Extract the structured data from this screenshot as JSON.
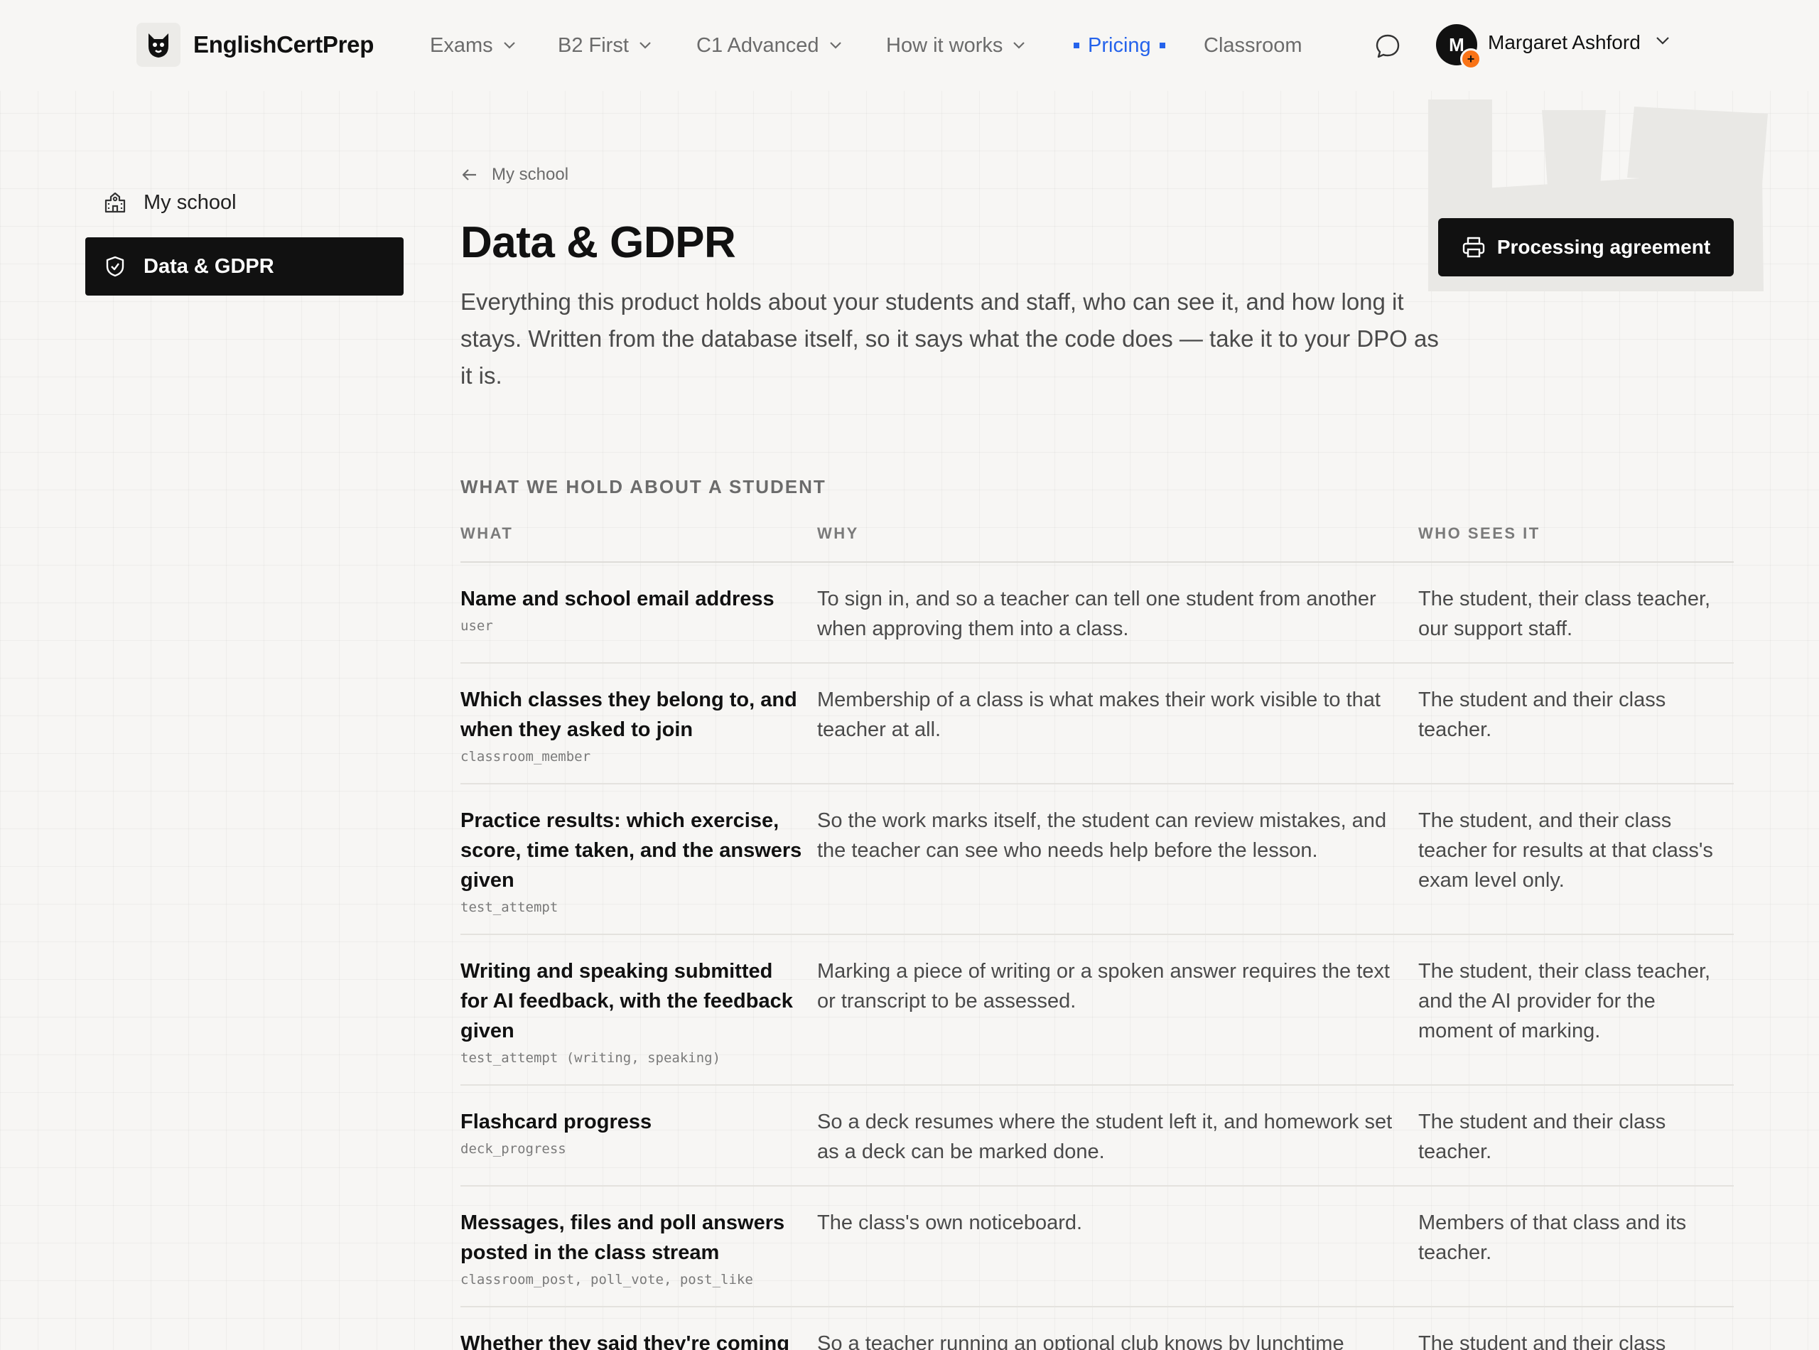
{
  "brand": {
    "name": "EnglishCertPrep"
  },
  "nav": [
    {
      "label": "Exams"
    },
    {
      "label": "B2 First"
    },
    {
      "label": "C1 Advanced"
    },
    {
      "label": "How it works"
    },
    {
      "label": "Pricing"
    },
    {
      "label": "Classroom"
    }
  ],
  "user": {
    "initial": "M",
    "badge": "+",
    "name": "Margaret Ashford"
  },
  "sidebar": {
    "items": [
      {
        "label": "My school"
      },
      {
        "label": "Data & GDPR"
      }
    ]
  },
  "breadcrumb": {
    "label": "My school"
  },
  "page": {
    "title": "Data & GDPR",
    "intro": "Everything this product holds about your students and staff, who can see it, and how long it stays. Written from the database itself, so it says what the code does — take it to your DPO as it is.",
    "print_button": "Processing agreement"
  },
  "section": {
    "label": "WHAT WE HOLD ABOUT A STUDENT",
    "columns": [
      "WHAT",
      "WHY",
      "WHO SEES IT"
    ],
    "rows": [
      {
        "what": "Name and school email address",
        "table": "user",
        "why": "To sign in, and so a teacher can tell one student from another when approving them into a class.",
        "who": "The student, their class teacher, our support staff."
      },
      {
        "what": "Which classes they belong to, and when they asked to join",
        "table": "classroom_member",
        "why": "Membership of a class is what makes their work visible to that teacher at all.",
        "who": "The student and their class teacher."
      },
      {
        "what": "Practice results: which exercise, score, time taken, and the answers given",
        "table": "test_attempt",
        "why": "So the work marks itself, the student can review mistakes, and the teacher can see who needs help before the lesson.",
        "who": "The student, and their class teacher for results at that class's exam level only."
      },
      {
        "what": "Writing and speaking submitted for AI feedback, with the feedback given",
        "table": "test_attempt (writing, speaking)",
        "why": "Marking a piece of writing or a spoken answer requires the text or transcript to be assessed.",
        "who": "The student, their class teacher, and the AI provider for the moment of marking."
      },
      {
        "what": "Flashcard progress",
        "table": "deck_progress",
        "why": "So a deck resumes where the student left it, and homework set as a deck can be marked done.",
        "who": "The student and their class teacher."
      },
      {
        "what": "Messages, files and poll answers posted in the class stream",
        "table": "classroom_post, poll_vote, post_like",
        "why": "The class's own noticeboard.",
        "who": "Members of that class and its teacher."
      },
      {
        "what": "Whether they said they're coming",
        "table": "",
        "why": "So a teacher running an optional club knows by lunchtime",
        "who": "The student and their class"
      }
    ]
  }
}
